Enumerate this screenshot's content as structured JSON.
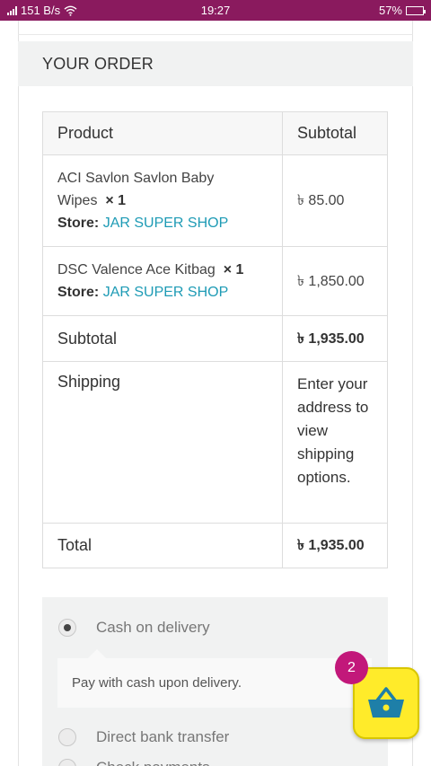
{
  "status_bar": {
    "net_speed": "151 B/s",
    "time": "19:27",
    "battery_pct": "57%",
    "battery_fraction": 0.57,
    "icons": [
      "signal-icon",
      "wifi-icon",
      "battery-icon"
    ]
  },
  "order": {
    "heading": "YOUR ORDER",
    "table": {
      "col_product": "Product",
      "col_subtotal": "Subtotal",
      "items": [
        {
          "name": "ACI Savlon Savlon Baby Wipes",
          "qty": "× 1",
          "store_label": "Store:",
          "store_name": "JAR SUPER SHOP",
          "price": "৳ 85.00"
        },
        {
          "name": "DSC Valence Ace Kitbag",
          "qty": "× 1",
          "store_label": "Store:",
          "store_name": "JAR SUPER SHOP",
          "price": "৳ 1,850.00"
        }
      ],
      "subtotal_label": "Subtotal",
      "subtotal_value": "৳ 1,935.00",
      "shipping_label": "Shipping",
      "shipping_value": "Enter your address to view shipping options.",
      "total_label": "Total",
      "total_value": "৳ 1,935.00"
    }
  },
  "payment": {
    "options": [
      {
        "label": "Cash on delivery",
        "selected": true,
        "description": "Pay with cash upon delivery."
      },
      {
        "label": "Direct bank transfer",
        "selected": false
      },
      {
        "label": "Check payments",
        "selected": false
      }
    ]
  },
  "cart": {
    "count": "2",
    "icon": "shopping-basket-icon",
    "colors": {
      "button": "#ffeb2a",
      "badge": "#c2187a"
    }
  },
  "colors": {
    "status_bar": "#8a1a5e",
    "store_link": "#1e9bb5",
    "heading_bg": "#f1f2f2"
  }
}
